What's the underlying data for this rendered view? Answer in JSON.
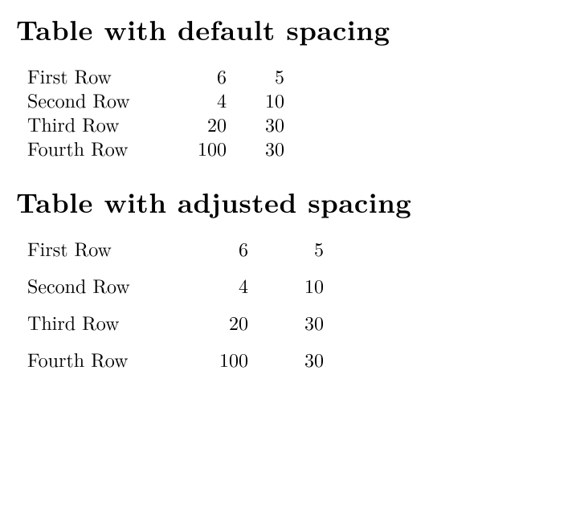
{
  "sections": [
    {
      "heading": "Table with default spacing",
      "table_class": "table-default",
      "rows": [
        {
          "label": "First Row",
          "a": "6",
          "b": "5"
        },
        {
          "label": "Second Row",
          "a": "4",
          "b": "10"
        },
        {
          "label": "Third Row",
          "a": "20",
          "b": "30"
        },
        {
          "label": "Fourth Row",
          "a": "100",
          "b": "30"
        }
      ]
    },
    {
      "heading": "Table with adjusted spacing",
      "table_class": "table-adjusted",
      "rows": [
        {
          "label": "First Row",
          "a": "6",
          "b": "5"
        },
        {
          "label": "Second Row",
          "a": "4",
          "b": "10"
        },
        {
          "label": "Third Row",
          "a": "20",
          "b": "30"
        },
        {
          "label": "Fourth Row",
          "a": "100",
          "b": "30"
        }
      ]
    }
  ]
}
